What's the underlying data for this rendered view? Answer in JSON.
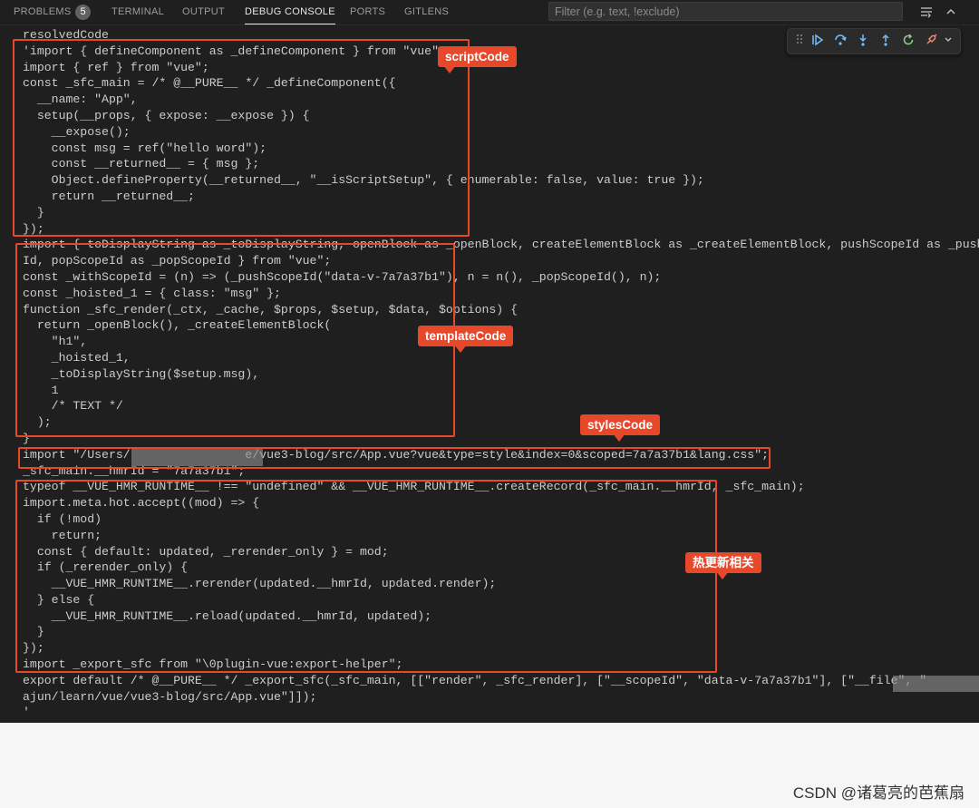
{
  "tabs": [
    {
      "label": "PROBLEMS",
      "count": "5"
    },
    {
      "label": "TERMINAL"
    },
    {
      "label": "OUTPUT"
    },
    {
      "label": "DEBUG CONSOLE",
      "active": true
    },
    {
      "label": "PORTS"
    },
    {
      "label": "GITLENS"
    }
  ],
  "filter": {
    "placeholder": "Filter (e.g. text, !exclude)",
    "value": ""
  },
  "toolbar_icons": [
    "word-wrap-icon",
    "chevron-up-icon"
  ],
  "debug_toolbar": [
    "drag-handle-icon",
    "continue-icon",
    "step-over-icon",
    "step-into-icon",
    "step-out-icon",
    "restart-icon",
    "disconnect-icon",
    "chevron-down-icon"
  ],
  "console_lines": [
    "resolvedCode",
    "'import { defineComponent as _defineComponent } from \"vue\";",
    "import { ref } from \"vue\";",
    "const _sfc_main = /* @__PURE__ */ _defineComponent({",
    "  __name: \"App\",",
    "  setup(__props, { expose: __expose }) {",
    "    __expose();",
    "    const msg = ref(\"hello word\");",
    "    const __returned__ = { msg };",
    "    Object.defineProperty(__returned__, \"__isScriptSetup\", { enumerable: false, value: true });",
    "    return __returned__;",
    "  }",
    "});",
    "import { toDisplayString as _toDisplayString, openBlock as _openBlock, createElementBlock as _createElementBlock, pushScopeId as _pushScopeId, popScopeId as _popScopeId } from \"vue\";",
    "Id, popScopeId as _popScopeId } from \"vue\";",
    "const _withScopeId = (n) => (_pushScopeId(\"data-v-7a7a37b1\"), n = n(), _popScopeId(), n);",
    "const _hoisted_1 = { class: \"msg\" };",
    "function _sfc_render(_ctx, _cache, $props, $setup, $data, $options) {",
    "  return _openBlock(), _createElementBlock(",
    "    \"h1\",",
    "    _hoisted_1,",
    "    _toDisplayString($setup.msg),",
    "    1",
    "    /* TEXT */",
    "  );",
    "}",
    "import \"/Users/                e/vue3-blog/src/App.vue?vue&type=style&index=0&scoped=7a7a37b1&lang.css\";",
    "_sfc_main.__hmrId = \"7a7a37b1\";",
    "typeof __VUE_HMR_RUNTIME__ !== \"undefined\" && __VUE_HMR_RUNTIME__.createRecord(_sfc_main.__hmrId, _sfc_main);",
    "import.meta.hot.accept((mod) => {",
    "  if (!mod)",
    "    return;",
    "  const { default: updated, _rerender_only } = mod;",
    "  if (_rerender_only) {",
    "    __VUE_HMR_RUNTIME__.rerender(updated.__hmrId, updated.render);",
    "  } else {",
    "    __VUE_HMR_RUNTIME__.reload(updated.__hmrId, updated);",
    "  }",
    "});",
    "import _export_sfc from \"\\0plugin-vue:export-helper\";",
    "export default /* @__PURE__ */ _export_sfc(_sfc_main, [[\"render\", _sfc_render], [\"__scopeId\", \"data-v-7a7a37b1\"], [\"__file\", \"",
    "ajun/learn/vue/vue3-blog/src/App.vue\"]]);",
    "'"
  ],
  "annotations": {
    "script": "scriptCode",
    "template": "templateCode",
    "styles": "stylesCode",
    "hmr": "热更新相关"
  },
  "annotation_color": "#e8482a",
  "watermark": "CSDN @诸葛亮的芭蕉扇"
}
